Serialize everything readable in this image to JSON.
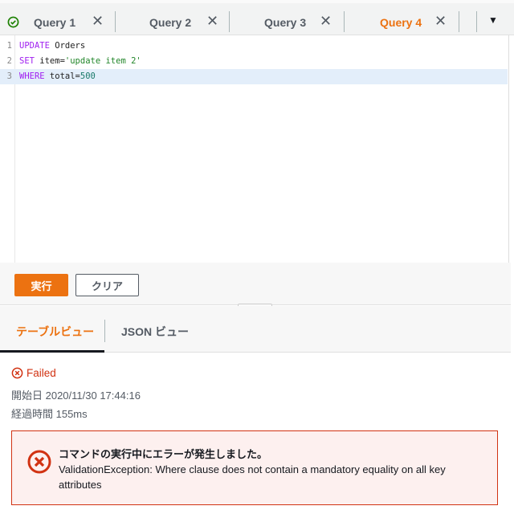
{
  "tabs": [
    {
      "label": "Query 1",
      "status": "success"
    },
    {
      "label": "Query 2"
    },
    {
      "label": "Query 3"
    },
    {
      "label": "Query 4",
      "active": true
    }
  ],
  "editor": {
    "lines": [
      {
        "n": "1",
        "kw": "UPDATE",
        "rest": " Orders"
      },
      {
        "n": "2",
        "kw": "SET",
        "rest": " item=",
        "str": "'update item 2'"
      },
      {
        "n": "3",
        "kw": "WHERE",
        "rest": " total=",
        "num": "500"
      }
    ]
  },
  "buttons": {
    "run": "実行",
    "clear": "クリア"
  },
  "result_tabs": {
    "table": "テーブルビュー",
    "json": "JSON ビュー"
  },
  "result": {
    "status": "Failed",
    "start": "開始日 2020/11/30 17:44:16",
    "elapsed": "経過時間 155ms",
    "error_title": "コマンドの実行中にエラーが発生しました。",
    "error_detail": "ValidationException: Where clause does not contain a mandatory equality on all key attributes"
  },
  "colors": {
    "accent": "#ec7211",
    "error": "#d13212",
    "success": "#1d8102"
  }
}
